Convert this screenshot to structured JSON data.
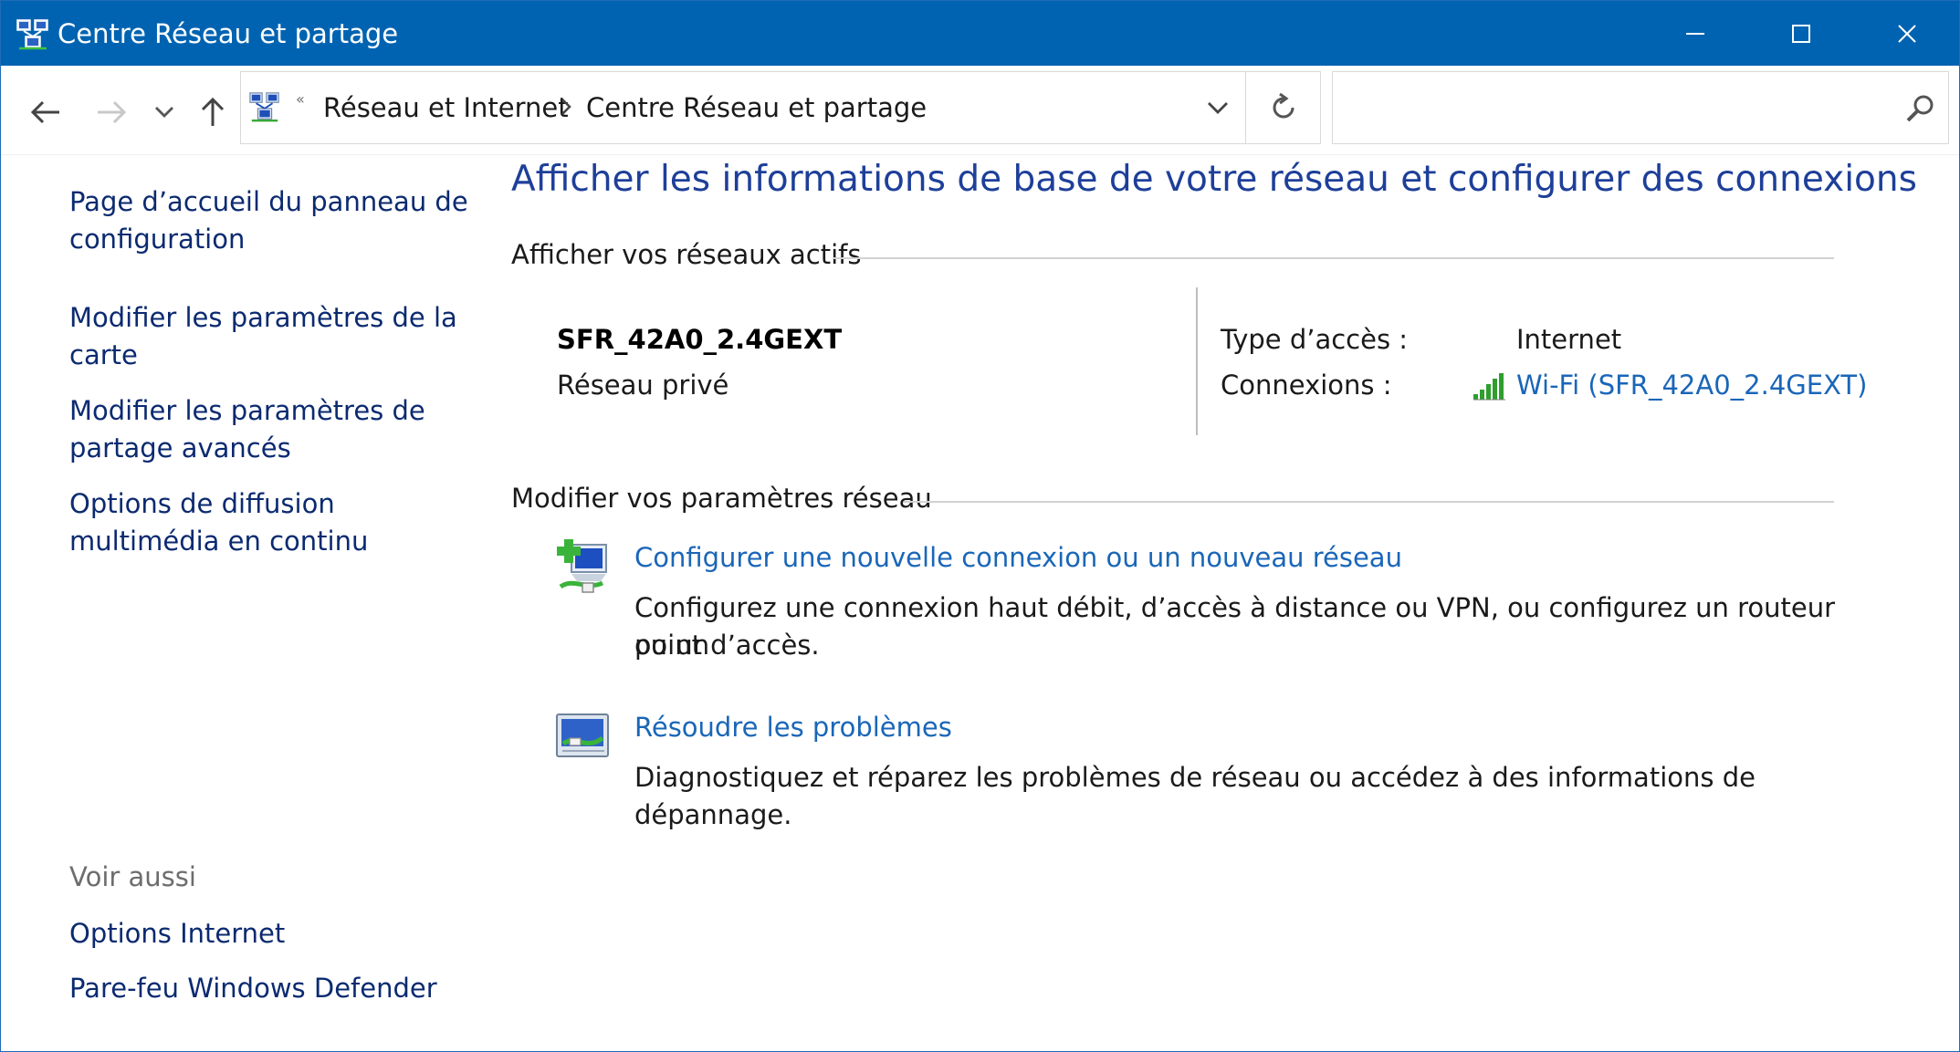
{
  "window": {
    "title": "Centre Réseau et partage",
    "accent_color": "#0063b1"
  },
  "nav": {
    "back_icon": "arrow-left-icon",
    "forward_icon": "arrow-right-icon",
    "recent_icon": "chevron-down-icon",
    "up_icon": "arrow-up-icon",
    "overflow_glyph": "«",
    "breadcrumb": [
      {
        "label": "Réseau et Internet"
      },
      {
        "label": "Centre Réseau et partage"
      }
    ],
    "search_placeholder": "",
    "search_value": ""
  },
  "left_pane": {
    "links": [
      {
        "label": "Page d’accueil du panneau de"
      },
      {
        "label": "configuration"
      },
      {
        "label": "Modifier les paramètres de la"
      },
      {
        "label": "carte"
      },
      {
        "label": "Modifier les paramètres de"
      },
      {
        "label": "partage avancés"
      },
      {
        "label": "Options de diffusion"
      },
      {
        "label": "multimédia en continu"
      }
    ],
    "see_also_title": "Voir aussi",
    "see_also": [
      {
        "label": "Options Internet"
      },
      {
        "label": "Pare-feu Windows Defender"
      }
    ]
  },
  "main": {
    "title": "Afficher les informations de base de votre réseau et configurer des connexions",
    "active_networks_heading": "Afficher vos réseaux actifs",
    "network": {
      "name": "SFR_42A0_2.4GEXT",
      "profile": "Réseau privé",
      "access_type_label": "Type d’accès :",
      "access_type_value": "Internet",
      "connections_label": "Connexions :",
      "connection_link": "Wi-Fi (SFR_42A0_2.4GEXT)",
      "signal_bars": 5
    },
    "change_settings_heading": "Modifier vos paramètres réseau",
    "tasks": [
      {
        "link": "Configurer une nouvelle connexion ou un nouveau réseau",
        "desc_line1": "Configurez une connexion haut débit, d’accès à distance ou VPN, ou configurez un routeur ou un",
        "desc_line2": "point d’accès."
      },
      {
        "link": "Résoudre les problèmes",
        "desc_line1": "Diagnostiquez et réparez les problèmes de réseau ou accédez à des informations de dépannage."
      }
    ]
  }
}
